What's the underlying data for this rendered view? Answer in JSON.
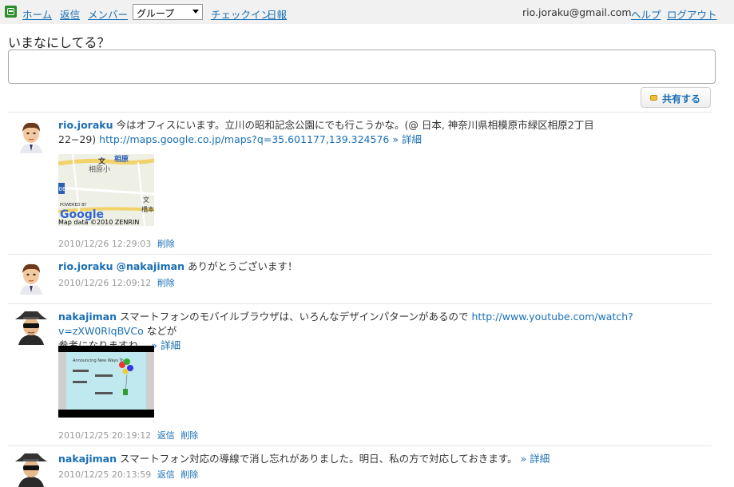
{
  "nav": {
    "home": "ホーム",
    "replies": "返信",
    "members": "メンバー",
    "group_select": "グループ",
    "checkin": "チェックイン",
    "diary": "日報",
    "email": "rio.joraku@gmail.com",
    "help": "ヘルプ",
    "logout": "ログアウト"
  },
  "compose": {
    "prompt": "いまなにしてる？",
    "share": "共有する"
  },
  "posts": [
    {
      "user": "rio.joraku",
      "text": "今はオフィスにいます。立川の昭和記念公園にでも行こうかな。(@ 日本, 神奈川県相模原市緑区相原2丁目",
      "text2": "22−29)",
      "link": "http://maps.google.co.jp/maps?q=35.601177,139.324576",
      "more": "» 詳細",
      "map": {
        "label1": "相原",
        "label2": "相原小",
        "label3": "文",
        "label4": "橋本",
        "label5": "06",
        "powered": "POWERED BY",
        "brand": "Google",
        "copyright": "Map data ©2010 ZENRIN"
      },
      "time": "2010/12/26 12:29:03",
      "delete": "削除"
    },
    {
      "user": "rio.joraku",
      "mention": "@nakajiman",
      "text": "ありがとうございます！",
      "time": "2010/12/26 12:09:12",
      "delete": "削除"
    },
    {
      "user": "nakajiman",
      "text": "スマートフォンのモバイルブラウザは、いろんなデザインパターンがあるので",
      "link": "http://www.youtube.com/watch?v=zXW0RIqBVCo",
      "text_after": "などが",
      "text2": "参考になりますね。",
      "more": "» 詳細",
      "video_title": "Announcing New Ways To",
      "time": "2010/12/25 20:19:12",
      "reply": "返信",
      "delete": "削除"
    },
    {
      "user": "nakajiman",
      "text": "スマートフォン対応の導線で消し忘れがありました。明日、私の方で対応しておきます。",
      "more": "» 詳細",
      "time": "2010/12/25 20:13:59",
      "reply": "返信",
      "delete": "削除"
    }
  ]
}
